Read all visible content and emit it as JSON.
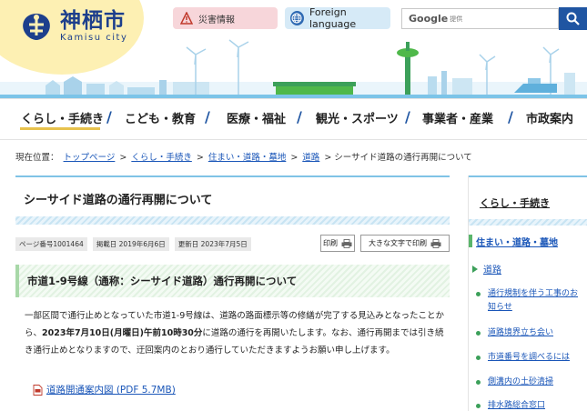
{
  "header": {
    "city_name": "神栖市",
    "city_roman": "Kamisu city",
    "disaster_label": "災害情報",
    "foreign_label": "Foreign language",
    "search_brand": "Google",
    "search_sub": "提供"
  },
  "nav": {
    "items": [
      {
        "label": "くらし・手続き"
      },
      {
        "label": "こども・教育"
      },
      {
        "label": "医療・福祉"
      },
      {
        "label": "観光・スポーツ"
      },
      {
        "label": "事業者・産業"
      },
      {
        "label": "市政案内"
      }
    ]
  },
  "breadcrumb": {
    "prefix": "現在位置：",
    "links": [
      "トップページ",
      "くらし・手続き",
      "住まい・道路・墓地",
      "道路"
    ],
    "current": "シーサイド道路の通行再開について",
    "separator": ">"
  },
  "main": {
    "title": "シーサイド道路の通行再開について",
    "page_number": "ページ番号1001464",
    "posted": "掲載日 2019年6月6日",
    "updated": "更新日 2023年7月5日",
    "print_label": "印刷",
    "print_large_label": "大きな文字で印刷",
    "section_heading": "市道1-9号線（通称：シーサイド道路）通行再開について",
    "body_before": "一部区間で通行止めとなっていた市道1-9号線は、道路の路面標示等の修繕が完了する見込みとなったことから、",
    "body_bold": "2023年7月10日(月曜日)午前10時30分",
    "body_after": "に道路の通行を再開いたします。なお、通行再開までは引き続き通行止めとなりますので、迂回案内のとおり通行していただきますようお願い申し上げます。",
    "pdf_link": "道路開通案内図 (PDF 5.7MB)"
  },
  "sidebar": {
    "heading": "くらし・手続き",
    "sub_heading": "住まい・道路・墓地",
    "category": "道路",
    "items": [
      {
        "label": "通行規制を伴う工事のお知らせ"
      },
      {
        "label": "道路境界立ち会い"
      },
      {
        "label": "市道番号を調べるには"
      },
      {
        "label": "側溝内の土砂清掃"
      },
      {
        "label": "排水路総合窓口"
      }
    ]
  },
  "colors": {
    "brand_blue": "#1f55a2",
    "accent_yellow": "#e7c24d",
    "title_border": "#7fc3e6",
    "sidebar_green": "#3ca05a"
  }
}
